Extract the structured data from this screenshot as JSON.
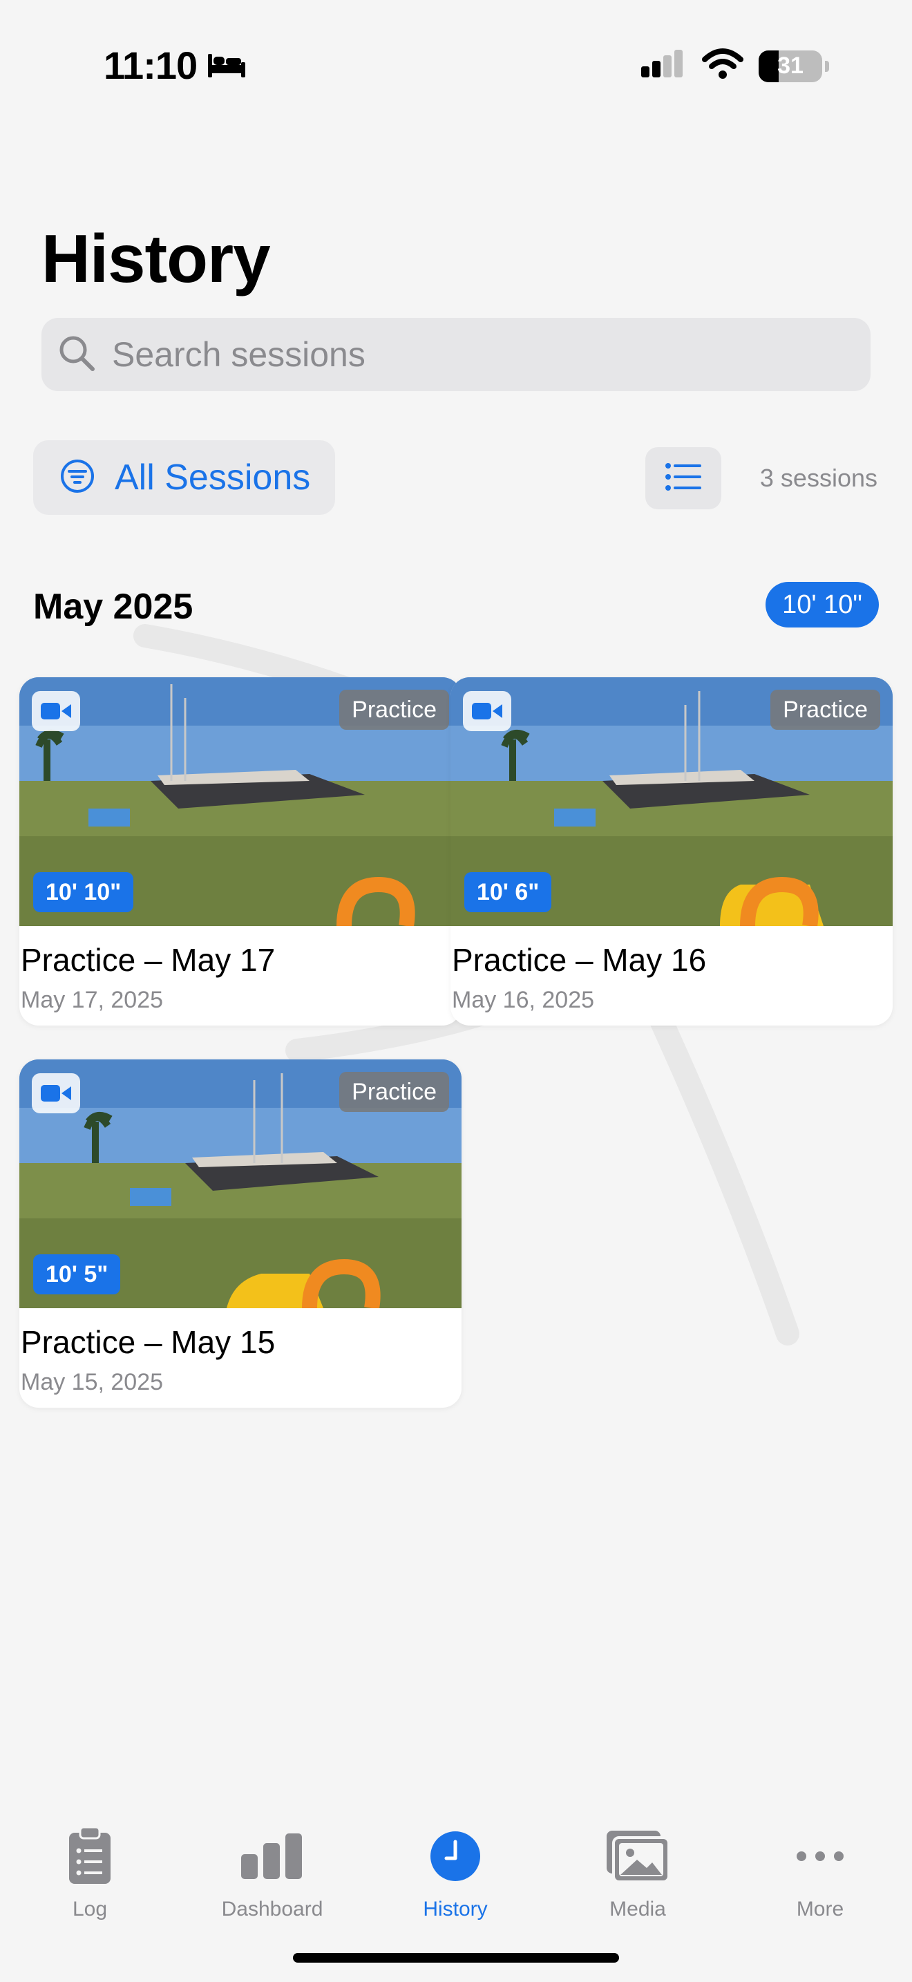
{
  "status_bar": {
    "time": "11:10",
    "battery_level": "31",
    "battery_fraction": 0.31,
    "icons": [
      "bed-icon",
      "cellular-signal-icon",
      "wifi-icon",
      "battery-icon"
    ]
  },
  "page": {
    "title": "History",
    "search_placeholder": "Search sessions"
  },
  "filter": {
    "label": "All Sessions",
    "session_count": "3 sessions"
  },
  "section": {
    "month": "May 2025",
    "best_height": "10' 10\""
  },
  "sessions": [
    {
      "title": "Practice – May 17",
      "date": "May 17, 2025",
      "type": "Practice",
      "height": "10' 10\""
    },
    {
      "title": "Practice – May 16",
      "date": "May 16, 2025",
      "type": "Practice",
      "height": "10' 6\""
    },
    {
      "title": "Practice – May 15",
      "date": "May 15, 2025",
      "type": "Practice",
      "height": "10' 5\""
    }
  ],
  "tab_bar": {
    "tabs": [
      {
        "label": "Log",
        "icon": "clipboard-list-icon"
      },
      {
        "label": "Dashboard",
        "icon": "bar-chart-icon"
      },
      {
        "label": "History",
        "icon": "clock-icon",
        "active": true
      },
      {
        "label": "Media",
        "icon": "photos-icon"
      },
      {
        "label": "More",
        "icon": "ellipsis-icon"
      }
    ]
  },
  "colors": {
    "accent": "#1a73e8",
    "background": "#f5f5f5",
    "secondary_text": "#8a8a8e"
  }
}
